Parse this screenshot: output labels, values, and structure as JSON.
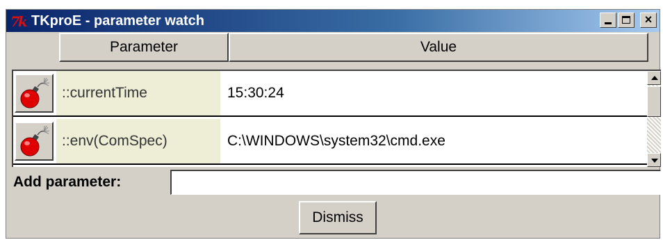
{
  "window": {
    "title": "TKproE - parameter watch",
    "logo_text": "7k",
    "controls": [
      "minimize-icon",
      "maximize-icon",
      "close-icon"
    ]
  },
  "table": {
    "headers": {
      "parameter": "Parameter",
      "value": "Value"
    },
    "rows": [
      {
        "icon": "bomb-icon",
        "parameter": "::currentTime",
        "value": "15:30:24"
      },
      {
        "icon": "bomb-icon",
        "parameter": "::env(ComSpec)",
        "value": "C:\\WINDOWS\\system32\\cmd.exe"
      }
    ]
  },
  "add_parameter": {
    "label": "Add parameter:",
    "value": ""
  },
  "buttons": {
    "dismiss": "Dismiss",
    "close_glyph": "×"
  },
  "colors": {
    "title_bar_start": "#0a246a",
    "param_cell_bg": "#eeeed6",
    "bomb_red": "#e00000",
    "window_bg": "#d4d0c8"
  }
}
